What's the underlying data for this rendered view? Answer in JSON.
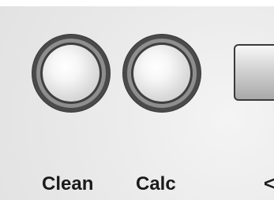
{
  "buttons": {
    "clean": {
      "label": "Clean"
    },
    "calc": {
      "label": "Calc"
    },
    "third": {
      "label": "<"
    }
  }
}
